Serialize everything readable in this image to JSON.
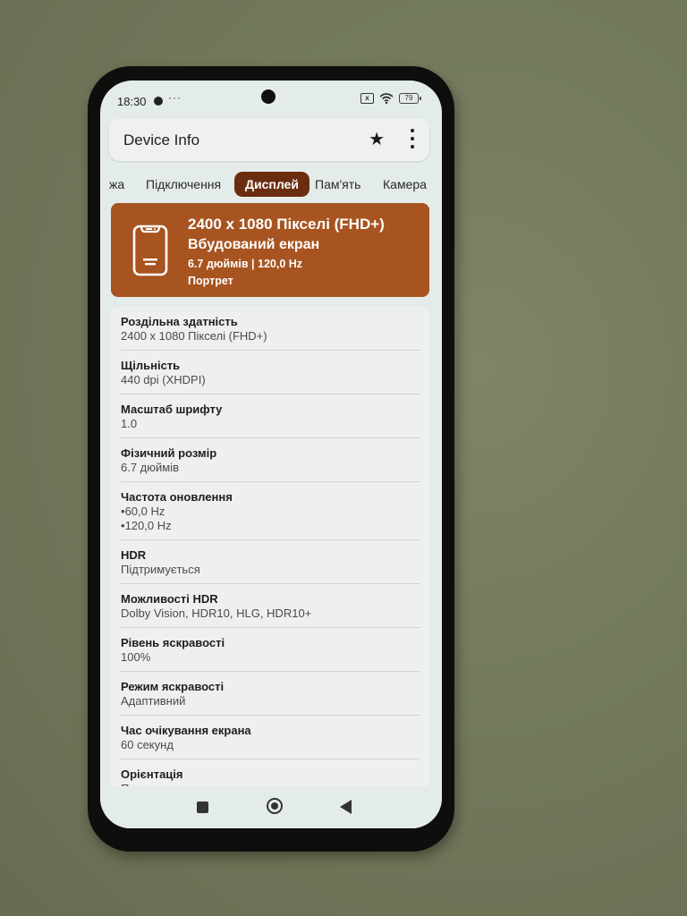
{
  "status_bar": {
    "time": "18:30",
    "more": "···",
    "sim_glyph": "x",
    "battery_level": "79"
  },
  "app_bar": {
    "title": "Device Info",
    "star_icon": "★",
    "menu_icon": "more-vert-icon"
  },
  "tabs": [
    {
      "label": "жа",
      "active": false
    },
    {
      "label": "Підключення",
      "active": false
    },
    {
      "label": "Дисплей",
      "active": true
    },
    {
      "label": "Пам'ять",
      "active": false
    },
    {
      "label": "Камера",
      "active": false
    }
  ],
  "hero": {
    "title": "2400 x 1080 Пікселі (FHD+)",
    "subtitle": "Вбудований екран",
    "line3": "6.7 дюймів | 120,0 Hz",
    "line4": "Портрет",
    "background": "#a75420"
  },
  "details": [
    {
      "label": "Роздільна здатність",
      "values": [
        "2400 x 1080 Пікселі (FHD+)"
      ]
    },
    {
      "label": "Щільність",
      "values": [
        "440 dpi (XHDPI)"
      ]
    },
    {
      "label": "Масштаб шрифту",
      "values": [
        "1.0"
      ]
    },
    {
      "label": "Фізичний розмір",
      "values": [
        "6.7 дюймів"
      ]
    },
    {
      "label": "Частота оновлення",
      "values": [
        "60,0 Hz",
        "120,0 Hz"
      ],
      "bulleted": true
    },
    {
      "label": "HDR",
      "values": [
        "Підтримується"
      ]
    },
    {
      "label": "Можливості HDR",
      "values": [
        "Dolby Vision, HDR10, HLG, HDR10+"
      ]
    },
    {
      "label": "Рівень яскравості",
      "values": [
        "100%"
      ]
    },
    {
      "label": "Режим яскравості",
      "values": [
        "Адаптивний"
      ]
    },
    {
      "label": "Час очікування екрана",
      "values": [
        "60 секунд"
      ]
    },
    {
      "label": "Орієнтація",
      "values": [
        "Портрет"
      ]
    }
  ],
  "colors": {
    "active_tab": "#6b2d0f",
    "hero_card": "#a75420",
    "screen_bg": "#e4ecea"
  }
}
